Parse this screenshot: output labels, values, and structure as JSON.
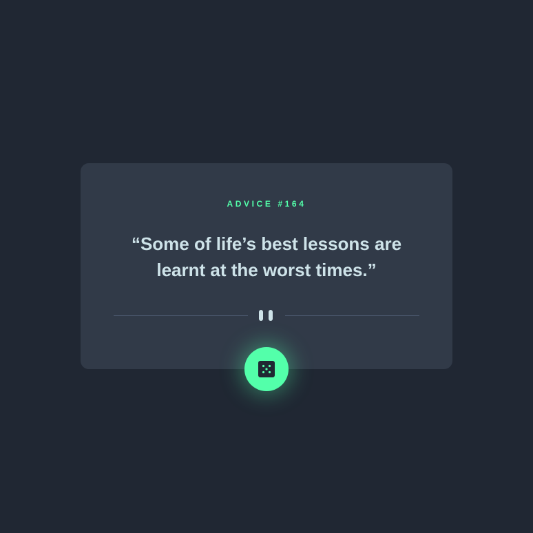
{
  "advice": {
    "label": "Advice #164",
    "quote": "“Some of life’s best lessons are learnt at the worst times.”"
  },
  "divider": {
    "icon": "pause-icon"
  },
  "button": {
    "icon": "dice-icon"
  },
  "colors": {
    "background": "#202733",
    "card": "#313a48",
    "accent": "#53ffaa",
    "text": "#cee3e9",
    "divider": "#4f5d74",
    "button_icon": "#202733"
  }
}
